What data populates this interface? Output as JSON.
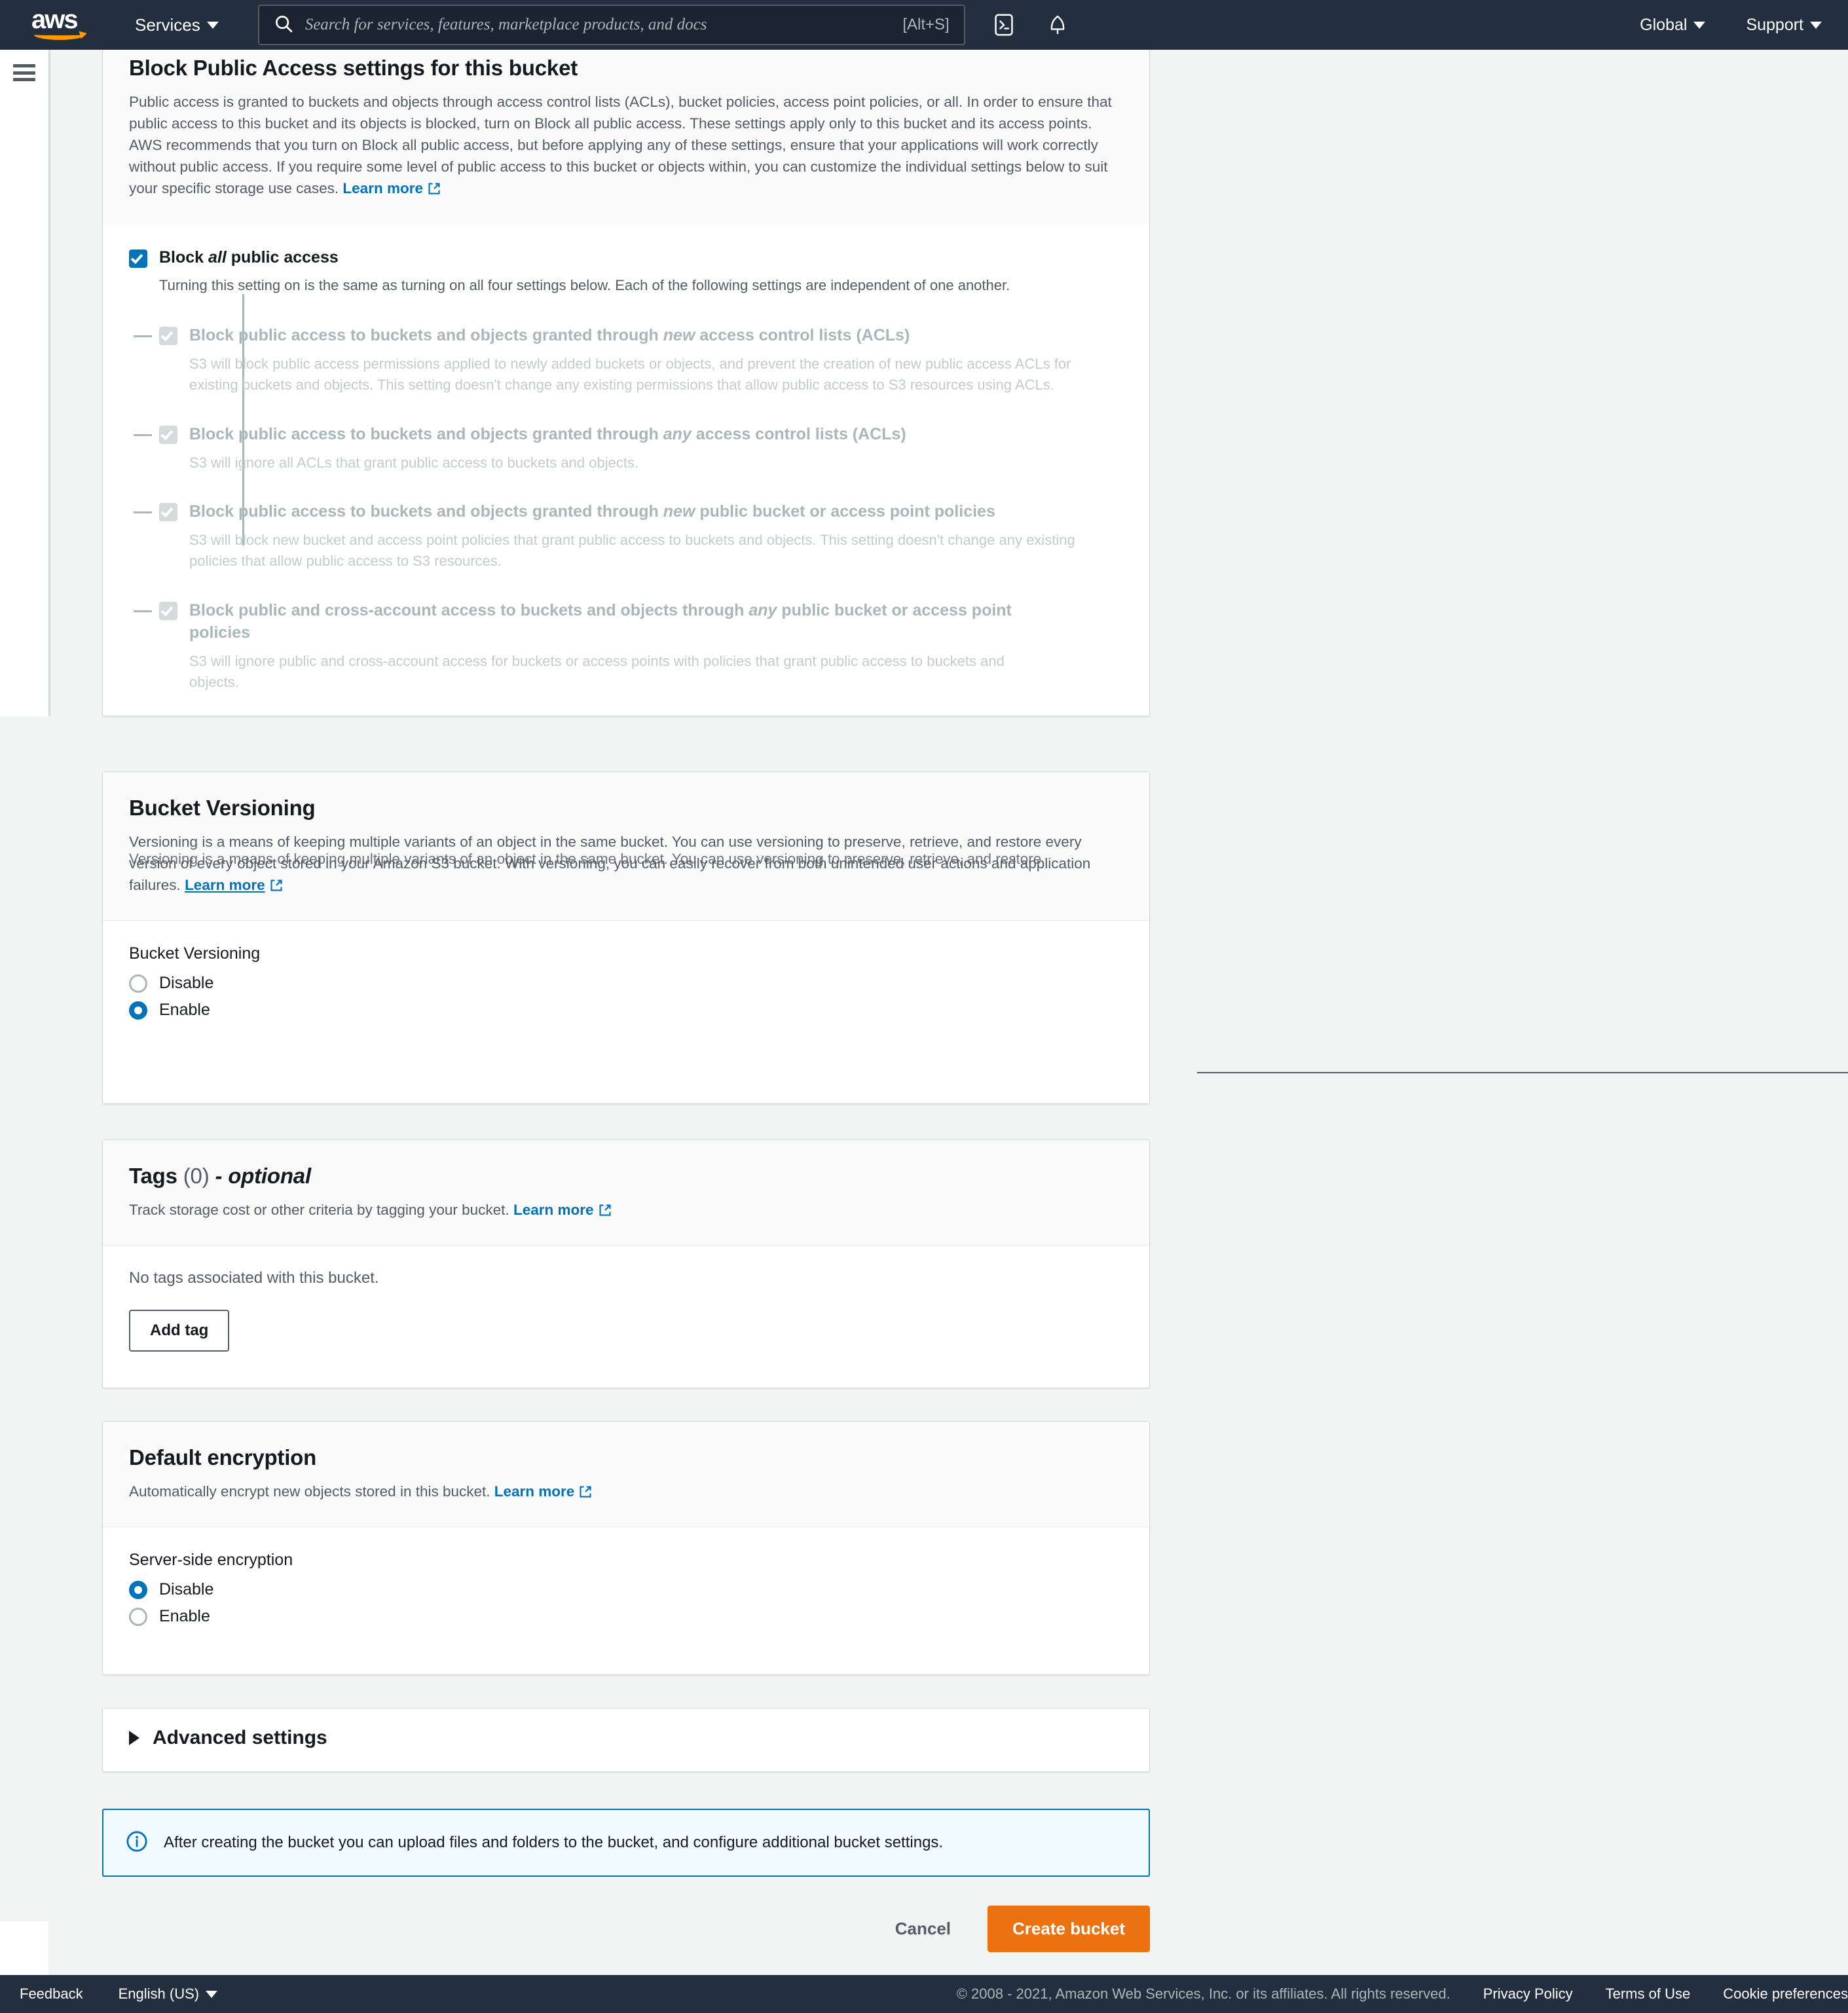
{
  "topnav": {
    "logo_text": "aws",
    "services_label": "Services",
    "search_placeholder": "Search for services, features, marketplace products, and docs",
    "search_value": "",
    "search_shortcut": "[Alt+S]",
    "cloudshell_icon": "cloudshell-icon",
    "bell_icon": "notifications-bell-icon",
    "region_label": "Global",
    "support_label": "Support"
  },
  "block_public_access": {
    "title": "Block Public Access settings for this bucket",
    "description": "Public access is granted to buckets and objects through access control lists (ACLs), bucket policies, access point policies, or all. In order to ensure that public access to this bucket and its objects is blocked, turn on Block all public access. These settings apply only to this bucket and its access points. AWS recommends that you turn on Block all public access, but before applying any of these settings, ensure that your applications will work correctly without public access. If you require some level of public access to this bucket or objects within, you can customize the individual settings below to suit your specific storage use cases.",
    "learn_more": "Learn more",
    "main_label_pre": "Block ",
    "main_label_em": "all",
    "main_label_post": " public access",
    "main_checked": true,
    "main_note": "Turning this setting on is the same as turning on all four settings below. Each of the following settings are independent of one another.",
    "sub_settings": [
      {
        "title_pre": "Block public access to buckets and objects granted through ",
        "title_em": "new",
        "title_post": " access control lists (ACLs)",
        "desc": "S3 will block public access permissions applied to newly added buckets or objects, and prevent the creation of new public access ACLs for existing buckets and objects. This setting doesn't change any existing permissions that allow public access to S3 resources using ACLs.",
        "checked": true,
        "disabled": true
      },
      {
        "title_pre": "Block public access to buckets and objects granted through ",
        "title_em": "any",
        "title_post": " access control lists (ACLs)",
        "desc": "S3 will ignore all ACLs that grant public access to buckets and objects.",
        "checked": true,
        "disabled": true
      },
      {
        "title_pre": "Block public access to buckets and objects granted through ",
        "title_em": "new",
        "title_post": " public bucket or access point policies",
        "desc": "S3 will block new bucket and access point policies that grant public access to buckets and objects. This setting doesn't change any existing policies that allow public access to S3 resources.",
        "checked": true,
        "disabled": true
      },
      {
        "title_pre": "Block public and cross-account access to buckets and objects through ",
        "title_em": "any",
        "title_post": " public bucket or access point policies",
        "desc": "S3 will ignore public and cross-account access for buckets or access points with policies that grant public access to buckets and objects.",
        "checked": true,
        "disabled": true
      }
    ]
  },
  "versioning": {
    "title": "Bucket Versioning",
    "description": "Versioning is a means of keeping multiple variants of an object in the same bucket. You can use versioning to preserve, retrieve, and restore every version of every object stored in your Amazon S3 bucket. With versioning, you can easily recover from both unintended user actions and application failures.",
    "description_dup": "Versioning is a means of keeping multiple variants of an object in the same bucket. You can use versioning to preserve, retrieve, and restore",
    "learn_more": "Learn more",
    "field_label": "Bucket Versioning",
    "options": [
      "Disable",
      "Enable"
    ],
    "selected": "Enable"
  },
  "tags": {
    "title_main": "Tags",
    "title_count": "(0)",
    "title_optional": "- optional",
    "description": "Track storage cost or other criteria by tagging your bucket.",
    "learn_more": "Learn more",
    "empty_message": "No tags associated with this bucket.",
    "add_tag_label": "Add tag"
  },
  "encryption": {
    "title": "Default encryption",
    "description": "Automatically encrypt new objects stored in this bucket.",
    "learn_more": "Learn more",
    "field_label": "Server-side encryption",
    "options": [
      "Disable",
      "Enable"
    ],
    "selected": "Disable"
  },
  "advanced": {
    "label": "Advanced settings",
    "expanded": false
  },
  "info_alert": {
    "icon": "info-circle-icon",
    "message": "After creating the bucket you can upload files and folders to the bucket, and configure additional bucket settings."
  },
  "actions": {
    "cancel_label": "Cancel",
    "create_label": "Create bucket"
  },
  "footer": {
    "feedback_label": "Feedback",
    "language_label": "English (US)",
    "copyright": "© 2008 - 2021, Amazon Web Services, Inc. or its affiliates. All rights reserved.",
    "privacy_label": "Privacy Policy",
    "terms_label": "Terms of Use",
    "cookie_label": "Cookie preferences"
  },
  "colors": {
    "nav_bg": "#232f3e",
    "accent_blue": "#0073bb",
    "accent_orange": "#ec7211",
    "page_bg": "#f2f3f3",
    "text_primary": "#16191f",
    "text_secondary": "#545b64",
    "disabled_gray": "#aab7b8"
  }
}
